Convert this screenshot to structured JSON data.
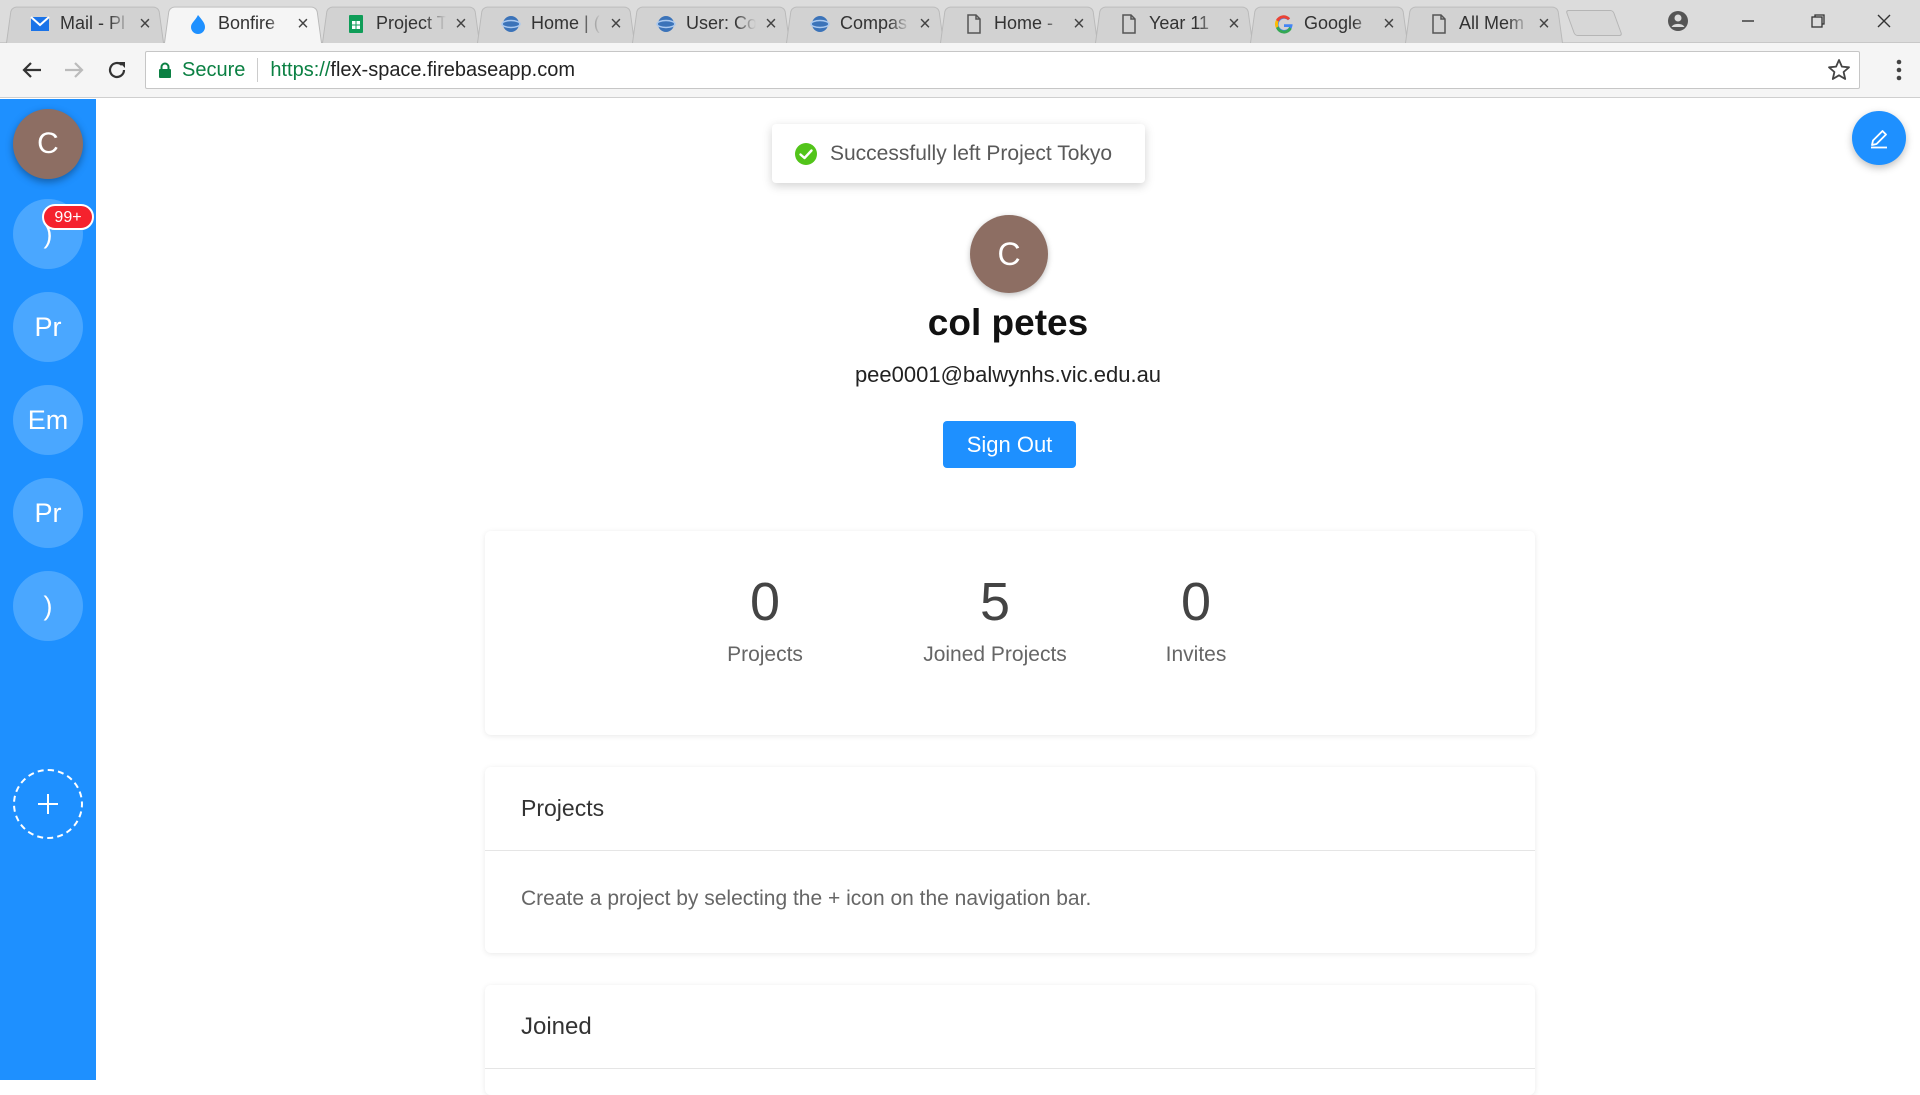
{
  "browser": {
    "tabs": [
      {
        "title": "Mail - Pl",
        "icon": "mail-icon"
      },
      {
        "title": "Bonfire",
        "icon": "flame-icon"
      },
      {
        "title": "Project T",
        "icon": "sheets-icon"
      },
      {
        "title": "Home | (",
        "icon": "globe-icon"
      },
      {
        "title": "User: Co",
        "icon": "globe-icon"
      },
      {
        "title": "Compas",
        "icon": "globe-icon"
      },
      {
        "title": "Home -",
        "icon": "document-icon"
      },
      {
        "title": "Year 11",
        "icon": "document-icon"
      },
      {
        "title": "Google",
        "icon": "google-icon"
      },
      {
        "title": "All Mem",
        "icon": "document-icon"
      }
    ],
    "active_tab_index": 1,
    "address": {
      "secure_label": "Secure",
      "scheme": "https://",
      "host": "flex-space.firebaseapp.com"
    }
  },
  "sidebar": {
    "user_initial": "C",
    "badge": "99+",
    "items": [
      {
        "label": ")"
      },
      {
        "label": "Pr"
      },
      {
        "label": "Em"
      },
      {
        "label": "Pr"
      },
      {
        "label": ")"
      }
    ]
  },
  "toast": {
    "message": "Successfully left Project Tokyo"
  },
  "profile": {
    "initial": "C",
    "name": "col petes",
    "email": "pee0001@balwynhs.vic.edu.au",
    "sign_out_label": "Sign Out"
  },
  "stats": [
    {
      "value": "0",
      "label": "Projects"
    },
    {
      "value": "5",
      "label": "Joined Projects"
    },
    {
      "value": "0",
      "label": "Invites"
    }
  ],
  "projects_panel": {
    "title": "Projects",
    "empty_message": "Create a project by selecting the + icon on the navigation bar."
  },
  "joined_panel": {
    "title": "Joined"
  },
  "colors": {
    "primary": "#1e90ff",
    "avatar": "#8d6e63",
    "badge": "#f5222d",
    "success": "#52c41a"
  }
}
